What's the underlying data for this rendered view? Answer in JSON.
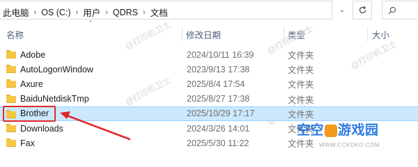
{
  "address_bar": {
    "crumbs": [
      "此电脑",
      "OS (C:)",
      "用户",
      "QDRS",
      "文档"
    ],
    "separator": "›",
    "search_icon": "search-icon",
    "refresh_icon": "refresh-icon"
  },
  "columns": {
    "name": "名称",
    "date": "修改日期",
    "type": "类型",
    "size": "大小"
  },
  "files": [
    {
      "name": "Adobe",
      "date": "2024/10/11 16:39",
      "type": "文件夹",
      "selected": false
    },
    {
      "name": "AutoLogonWindow",
      "date": "2023/9/13 17:38",
      "type": "文件夹",
      "selected": false
    },
    {
      "name": "Axure",
      "date": "2025/8/4 17:54",
      "type": "文件夹",
      "selected": false
    },
    {
      "name": "BaiduNetdiskTmp",
      "date": "2025/8/27 17:38",
      "type": "文件夹",
      "selected": false
    },
    {
      "name": "Brother",
      "date": "2025/10/29 17:17",
      "type": "文件夹",
      "selected": true
    },
    {
      "name": "Downloads",
      "date": "2024/3/26 14:01",
      "type": "文件夹",
      "selected": false
    },
    {
      "name": "Fax",
      "date": "2025/5/30 11:22",
      "type": "文件夹",
      "selected": false
    }
  ],
  "watermark": "@打印机卫士",
  "brand": {
    "part1": "空空",
    "part2": "游戏园",
    "url": "WWW.CCKOKO.COM"
  },
  "colors": {
    "selection": "#cce8ff",
    "highlight": "#e0282a",
    "folder": "#f6c744"
  }
}
